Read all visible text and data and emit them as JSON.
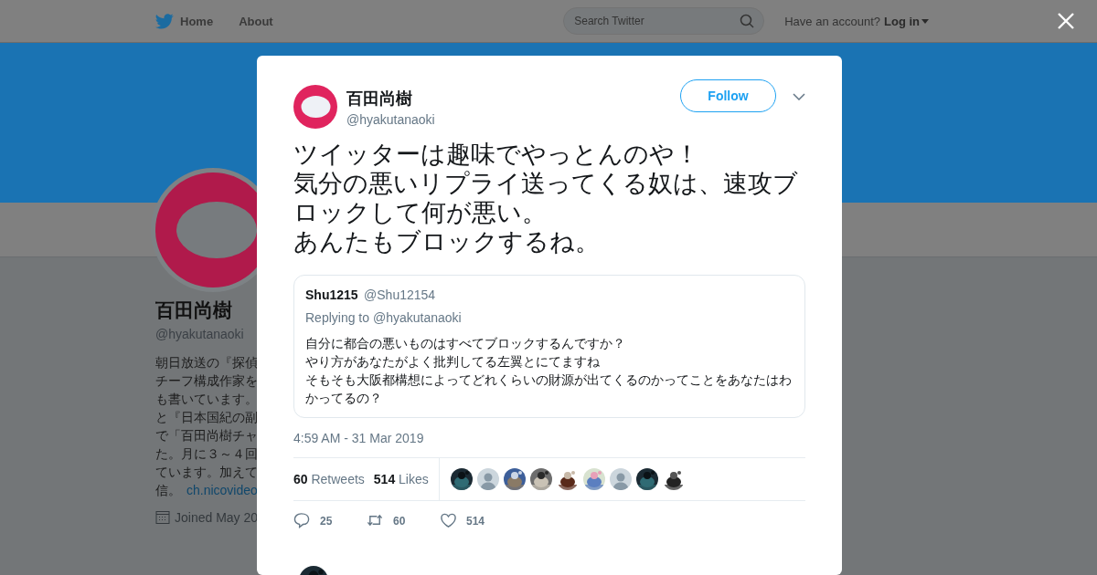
{
  "topbar": {
    "nav": [
      {
        "label": "Home",
        "selected": false
      },
      {
        "label": "About",
        "selected": false
      }
    ],
    "search": {
      "placeholder": "Search Twitter"
    },
    "account_prompt": "Have an account?",
    "login": "Log in"
  },
  "profile": {
    "name": "百田尚樹",
    "handle": "@hyakutanaoki",
    "bio_lines": [
      "朝日放送の『探偵",
      "チーフ構成作家を",
      "も書いています。",
      "と『日本国紀の副",
      "で「百田尚樹チャ",
      "た。月に３～４回",
      "ています。加えて",
      "信。"
    ],
    "bio_link": "ch.nicovideo",
    "joined": "Joined May 20"
  },
  "tweet": {
    "name": "百田尚樹",
    "handle": "@hyakutanaoki",
    "follow": "Follow",
    "text_lines": [
      "ツイッターは趣味でやっとんのや！",
      "気分の悪いリプライ送ってくる奴は、速攻ブロックして何が悪い。",
      "あんたもブロックするね。"
    ],
    "quote": {
      "name": "Shu1215",
      "handle": "@Shu12154",
      "replying": "Replying to @hyakutanaoki",
      "text_lines": [
        "自分に都合の悪いものはすべてブロックするんですか？",
        "やり方があなたがよく批判してる左翼とにてますね",
        "そもそも大阪都構想によってどれくらいの財源が出てくるのかってことをあなたはわかってるの？"
      ]
    },
    "time": "4:59 AM - 31 Mar 2019",
    "stats": [
      {
        "count": "60",
        "label": "Retweets"
      },
      {
        "count": "514",
        "label": "Likes"
      }
    ],
    "likers": [
      {
        "kind": "picture"
      },
      {
        "kind": "default"
      },
      {
        "kind": "picture"
      },
      {
        "kind": "picture"
      },
      {
        "kind": "picture"
      },
      {
        "kind": "picture"
      },
      {
        "kind": "default"
      },
      {
        "kind": "picture"
      },
      {
        "kind": "picture"
      }
    ],
    "actions": [
      {
        "kind": "reply",
        "count": "25"
      },
      {
        "kind": "retweet",
        "count": "60"
      },
      {
        "kind": "like",
        "count": "514"
      }
    ]
  }
}
